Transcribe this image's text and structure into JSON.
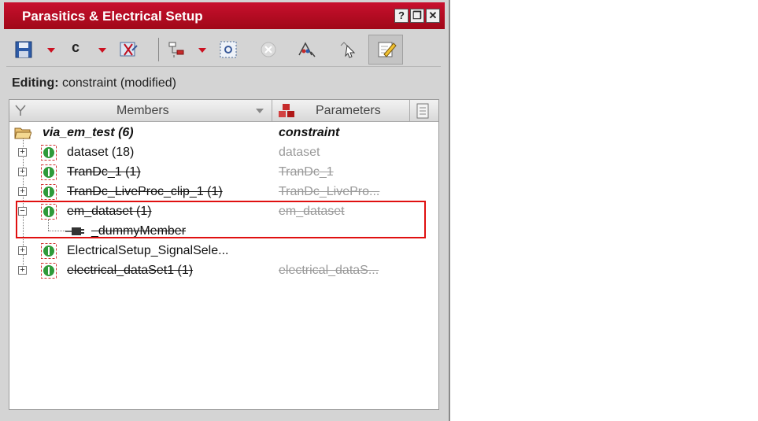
{
  "window": {
    "title": "Parasitics & Electrical Setup",
    "buttons": [
      "?",
      "❐",
      "✕"
    ]
  },
  "toolbar": {
    "c_label": "c"
  },
  "status": {
    "editing_label": "Editing:",
    "editing_value": "constraint (modified)"
  },
  "tree": {
    "headers": {
      "members": "Members",
      "parameters": "Parameters"
    },
    "root": {
      "name": "via_em_test (6)",
      "param": "constraint"
    },
    "rows": [
      {
        "name": "dataset (18)",
        "param": "dataset",
        "struck": false,
        "expanded": false
      },
      {
        "name": "TranDc_1 (1)",
        "param": "TranDc_1",
        "struck": true,
        "expanded": false
      },
      {
        "name": "TranDc_LiveProc_clip_1 (1)",
        "param": "TranDc_LivePro...",
        "struck": true,
        "expanded": false
      },
      {
        "name": "em_dataset (1)",
        "param": "em_dataset",
        "struck": true,
        "expanded": true
      },
      {
        "name": "_dummyMember",
        "param": "",
        "struck": true,
        "child": true
      },
      {
        "name": "ElectricalSetup_SignalSele...",
        "param": "",
        "struck": false,
        "expanded": false
      },
      {
        "name": "electrical_dataSet1 (1)",
        "param": "electrical_dataS...",
        "struck": true,
        "expanded": false
      }
    ]
  },
  "colors": {
    "title_bg": "#b80c22",
    "highlight": "#e01010",
    "node_green": "#2f9a3a"
  }
}
